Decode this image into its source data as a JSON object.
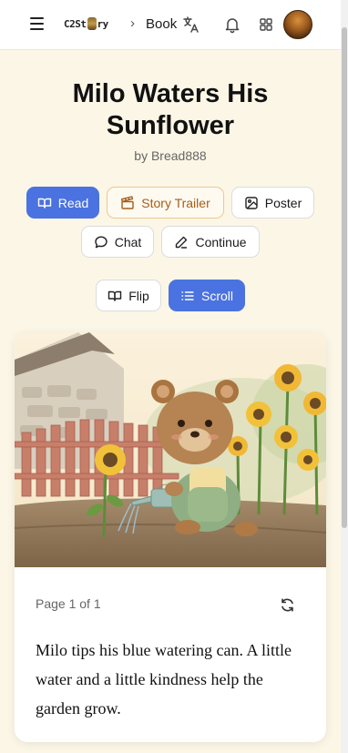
{
  "header": {
    "logo_text_before": "C2St",
    "logo_text_after": "ry",
    "breadcrumb": "Book",
    "icons": [
      "menu-icon",
      "translate-icon",
      "bell-icon",
      "apps-icon"
    ]
  },
  "story": {
    "title": "Milo Waters His Sunflower",
    "author": "by Bread888"
  },
  "actions": {
    "read": "Read",
    "trailer": "Story Trailer",
    "poster": "Poster",
    "chat": "Chat",
    "continue": "Continue"
  },
  "view_modes": {
    "flip": "Flip",
    "scroll": "Scroll",
    "selected": "Scroll"
  },
  "page": {
    "indicator": "Page 1 of 1",
    "text": "Milo tips his blue watering can. A little water and a little kindness help the garden grow."
  },
  "colors": {
    "primary": "#4a72e0",
    "trailer_text": "#a35e1a",
    "background": "#fbf6e6"
  }
}
